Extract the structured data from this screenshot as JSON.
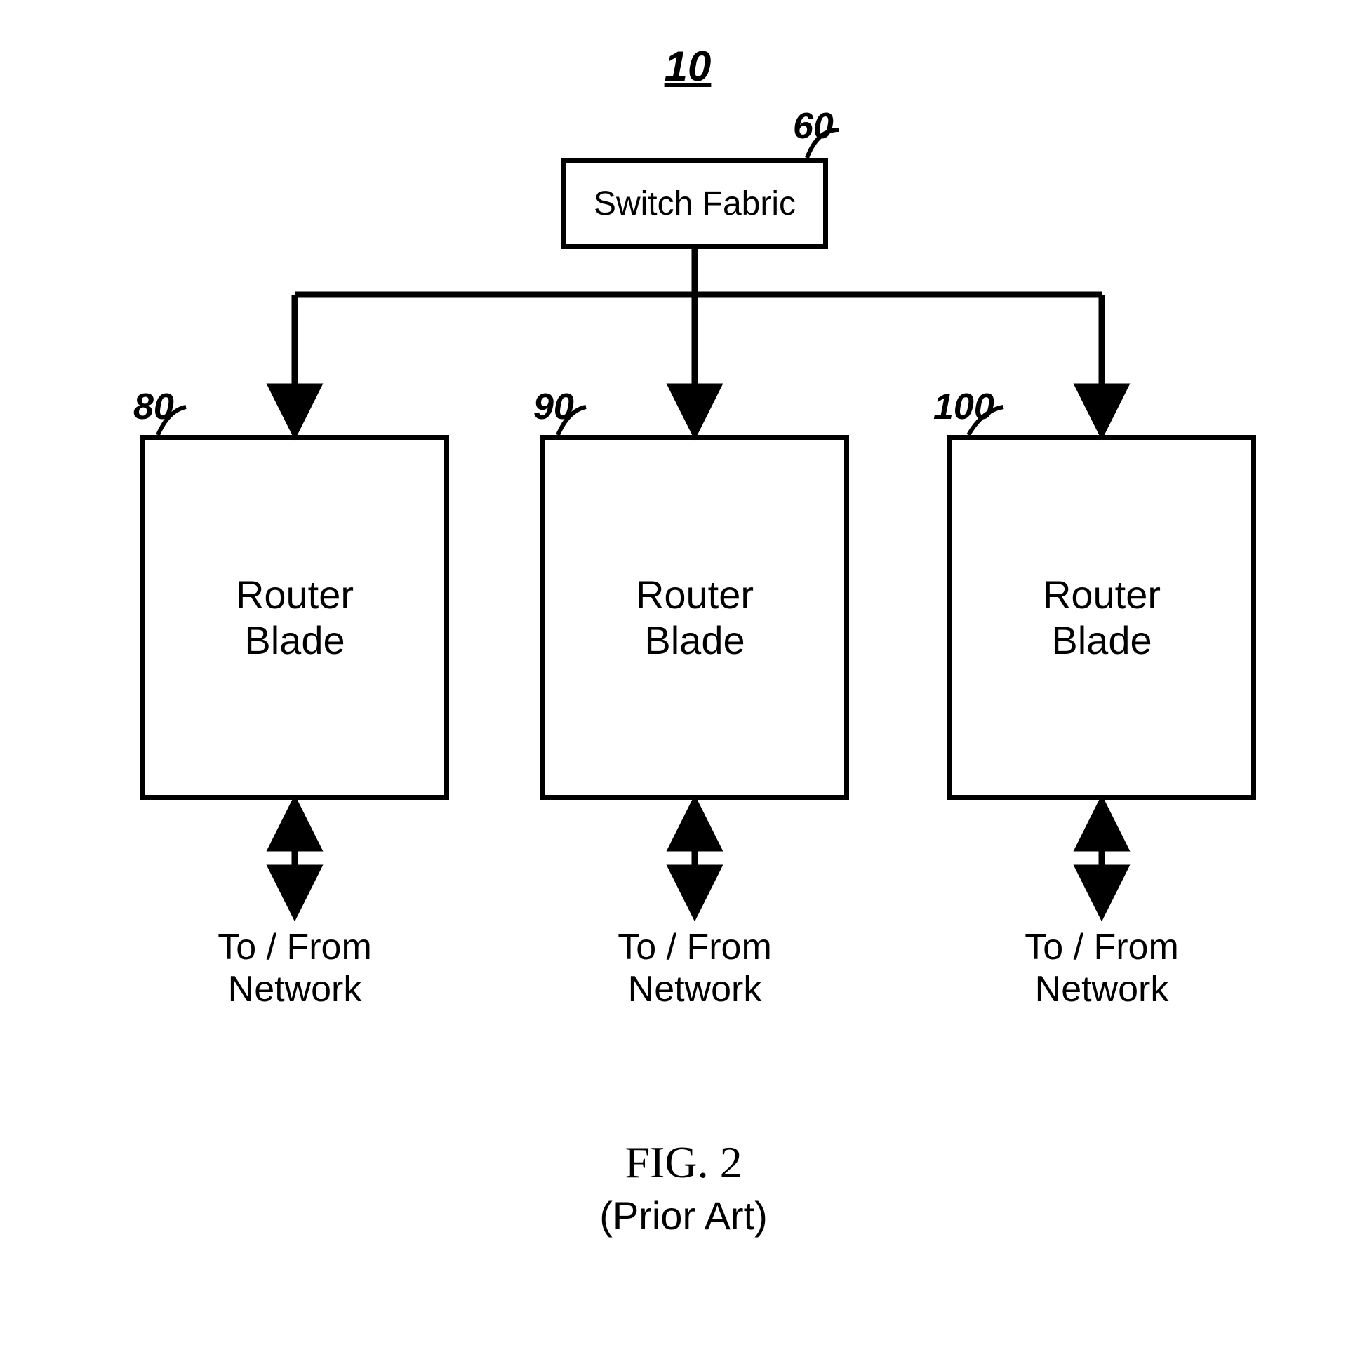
{
  "figure": {
    "id_label": "10",
    "caption": "FIG. 2",
    "subcaption": "(Prior Art)"
  },
  "switch_fabric": {
    "ref": "60",
    "label": "Switch Fabric"
  },
  "blades": [
    {
      "ref": "80",
      "label_line1": "Router",
      "label_line2": "Blade",
      "io_line1": "To / From",
      "io_line2": "Network"
    },
    {
      "ref": "90",
      "label_line1": "Router",
      "label_line2": "Blade",
      "io_line1": "To / From",
      "io_line2": "Network"
    },
    {
      "ref": "100",
      "label_line1": "Router",
      "label_line2": "Blade",
      "io_line1": "To / From",
      "io_line2": "Network"
    }
  ]
}
